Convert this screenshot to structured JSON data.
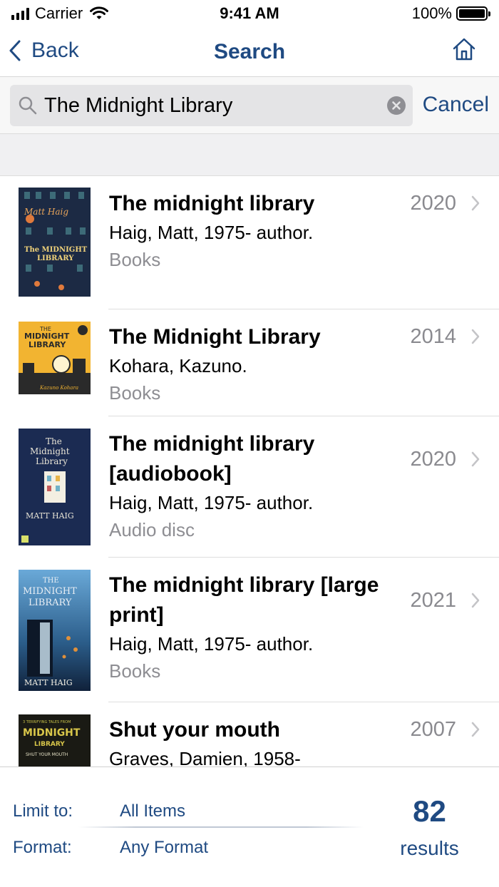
{
  "status_bar": {
    "carrier": "Carrier",
    "time": "9:41 AM",
    "battery": "100%",
    "icons": [
      "signal-icon",
      "wifi-icon",
      "battery-icon"
    ]
  },
  "nav": {
    "back_label": "Back",
    "title": "Search",
    "icons": [
      "chevron-left-icon",
      "home-icon"
    ]
  },
  "search": {
    "query": "The Midnight Library",
    "cancel_label": "Cancel",
    "icons": [
      "magnifier-icon",
      "clear-icon"
    ]
  },
  "results": [
    {
      "title": "The midnight library",
      "author": "Haig, Matt, 1975- author.",
      "format": "Books",
      "year": "2020",
      "cover_text": "Matt Haig · The Midnight Library"
    },
    {
      "title": "The Midnight Library",
      "author": "Kohara, Kazuno.",
      "format": "Books",
      "year": "2014",
      "cover_text": "The Midnight Library · Kazuno Kohara"
    },
    {
      "title_line1": "The midnight library",
      "title_line2": "[audiobook]",
      "author": "Haig, Matt, 1975- author.",
      "format": "Audio disc",
      "year": "2020",
      "cover_text": "The Midnight Library · Matt Haig"
    },
    {
      "title_line1": "The midnight library [large",
      "title_line2": "print]",
      "author": "Haig, Matt, 1975- author.",
      "format": "Books",
      "year": "2021",
      "cover_text": "The Midnight Library · Matt Haig"
    },
    {
      "title": "Shut your mouth",
      "author": "Graves, Damien, 1958-",
      "year": "2007",
      "cover_text": "Midnight Library · Shut Your Mouth"
    }
  ],
  "footer": {
    "limit_label": "Limit to:",
    "limit_value": "All Items",
    "format_label": "Format:",
    "format_value": "Any Format",
    "count": "82",
    "count_label": "results"
  },
  "colors": {
    "accent": "#1f4a82",
    "secondary_text": "#8e8e93",
    "search_field_bg": "#e4e4e6"
  }
}
